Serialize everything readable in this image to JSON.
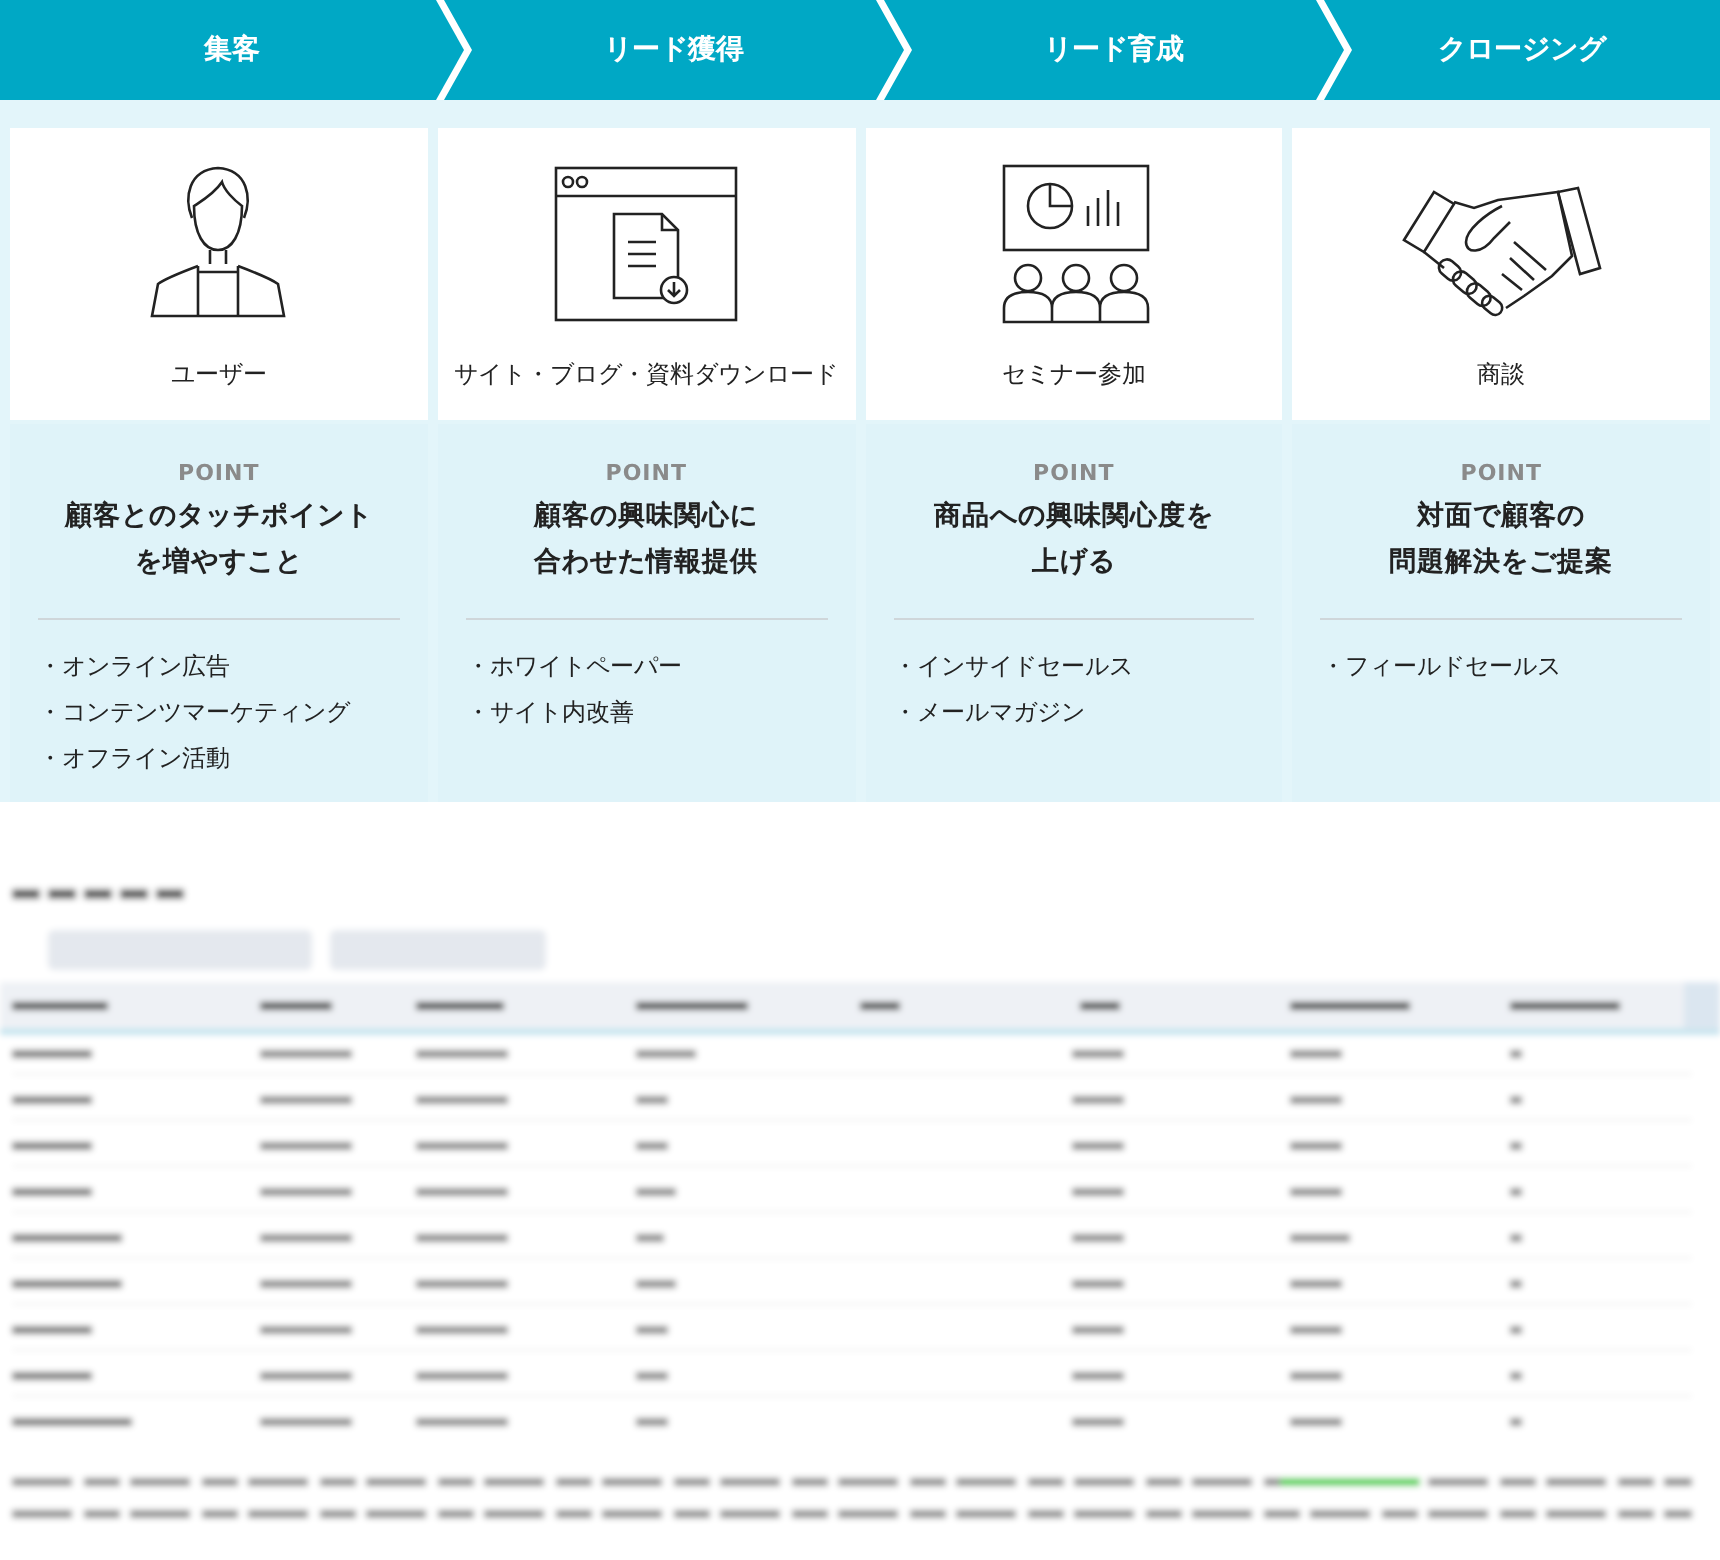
{
  "stages": [
    {
      "title": "集客",
      "kind": "person",
      "caption": "ユーザー",
      "point_label": "POINT",
      "point_lines": [
        "顧客とのタッチポイント",
        "を増やすこと"
      ],
      "items": [
        "・オンライン広告",
        "・コンテンツマーケティング",
        "・オフライン活動"
      ]
    },
    {
      "title": "リード獲得",
      "kind": "document",
      "caption": "サイト・ブログ・資料ダウンロード",
      "point_label": "POINT",
      "point_lines": [
        "顧客の興味関心に",
        "合わせた情報提供"
      ],
      "items": [
        "・ホワイトペーパー",
        "・サイト内改善"
      ]
    },
    {
      "title": "リード育成",
      "kind": "seminar",
      "caption": "セミナー参加",
      "point_label": "POINT",
      "point_lines": [
        "商品への興味関心度を",
        "上げる"
      ],
      "items": [
        "・インサイドセールス",
        "・メールマガジン"
      ]
    },
    {
      "title": "クロージング",
      "kind": "handshake",
      "caption": "商談",
      "point_label": "POINT",
      "point_lines": [
        "対面で顧客の",
        "問題解決をご提案"
      ],
      "items": [
        "・フィールドセールス"
      ]
    }
  ]
}
